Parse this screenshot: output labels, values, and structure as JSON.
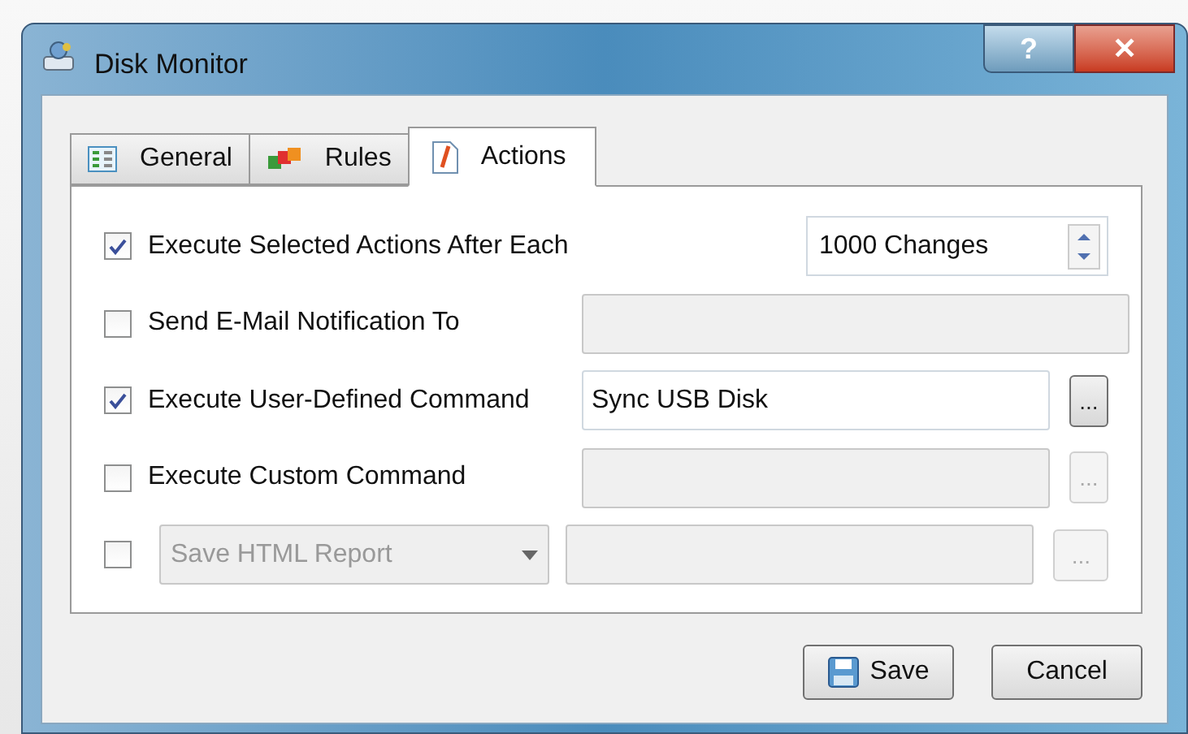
{
  "window": {
    "title": "Disk Monitor",
    "help_button": "?",
    "close_button": "✕"
  },
  "tabs": [
    {
      "label": "General",
      "selected": false
    },
    {
      "label": "Rules",
      "selected": false
    },
    {
      "label": "Actions",
      "selected": true
    }
  ],
  "actions": [
    {
      "kind": "spin",
      "label": "Execute Selected Actions After Each",
      "checked": true,
      "value": "1000 Changes"
    },
    {
      "kind": "text",
      "label": "Send E-Mail Notification To",
      "checked": false,
      "disabled": true
    },
    {
      "kind": "browse",
      "label": "Execute User-Defined Command",
      "checked": true,
      "disabled": false,
      "value": "Sync USB Disk",
      "browse": "..."
    },
    {
      "kind": "browse",
      "label": "Execute Custom Command",
      "checked": false,
      "disabled": true,
      "browse": "..."
    },
    {
      "kind": "combo",
      "selection": "Save HTML Report",
      "checked": false,
      "disabled": true,
      "browse": "..."
    }
  ],
  "buttons": [
    {
      "label": "Save",
      "kind": "save"
    },
    {
      "label": "Cancel",
      "kind": "cancel"
    }
  ]
}
